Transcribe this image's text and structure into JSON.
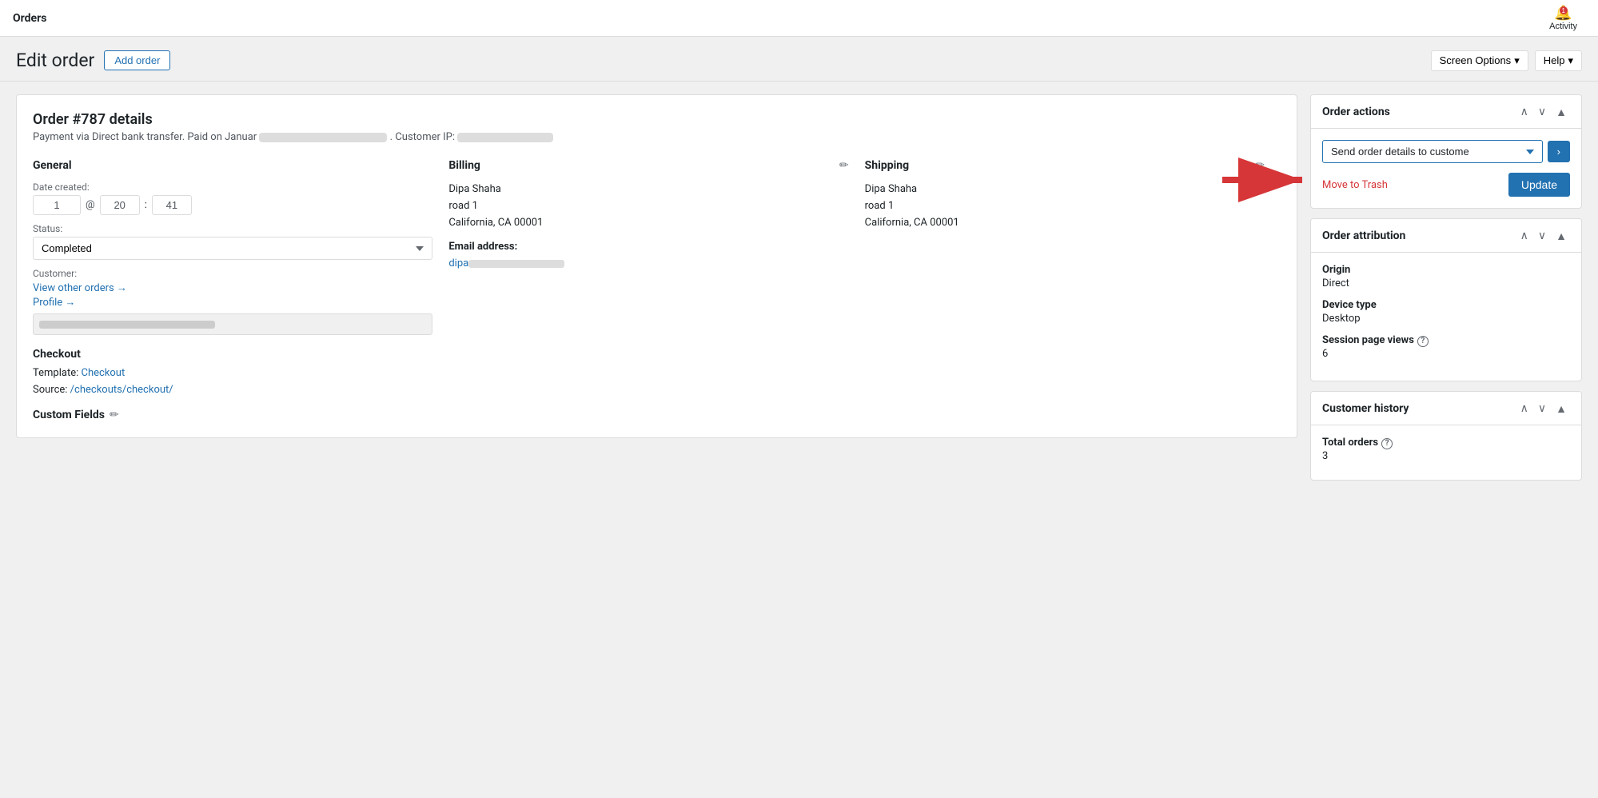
{
  "topbar": {
    "title": "Orders",
    "activity_label": "Activity",
    "activity_badge": "1"
  },
  "subheader": {
    "page_title": "Edit order",
    "add_order_btn": "Add order",
    "screen_options_btn": "Screen Options",
    "help_btn": "Help"
  },
  "order": {
    "title": "Order #787 details",
    "payment_info": "Payment via Direct bank transfer. Paid on Januar",
    "customer_ip_label": "Customer IP:",
    "general": {
      "section_title": "General",
      "date_label": "Date created:",
      "date_day": "1",
      "date_hour": "20",
      "date_min": "41",
      "status_label": "Status:",
      "status_value": "Completed",
      "customer_label": "Customer:",
      "view_other_orders_link": "View other orders →",
      "profile_link": "Profile →"
    },
    "checkout": {
      "section_title": "Checkout",
      "template_label": "Template:",
      "template_link": "Checkout",
      "source_label": "Source:",
      "source_link": "/checkouts/checkout/"
    },
    "custom_fields": {
      "section_title": "Custom Fields",
      "edit_icon": "✏"
    },
    "billing": {
      "section_title": "Billing",
      "name": "Dipa Shaha",
      "address1": "road 1",
      "city_state_zip": "California, CA 00001",
      "email_label": "Email address:",
      "email": "dipa"
    },
    "shipping": {
      "section_title": "Shipping",
      "name": "Dipa Shaha",
      "address1": "road 1",
      "city_state_zip": "California, CA 00001"
    }
  },
  "order_actions": {
    "panel_title": "Order actions",
    "select_value": "Send order details to custome",
    "go_btn": "›",
    "trash_link": "Move to Trash",
    "update_btn": "Update"
  },
  "order_attribution": {
    "panel_title": "Order attribution",
    "origin_label": "Origin",
    "origin_value": "Direct",
    "device_label": "Device type",
    "device_value": "Desktop",
    "session_label": "Session page views",
    "session_value": "6"
  },
  "customer_history": {
    "panel_title": "Customer history",
    "total_orders_label": "Total orders",
    "total_orders_value": "3"
  }
}
